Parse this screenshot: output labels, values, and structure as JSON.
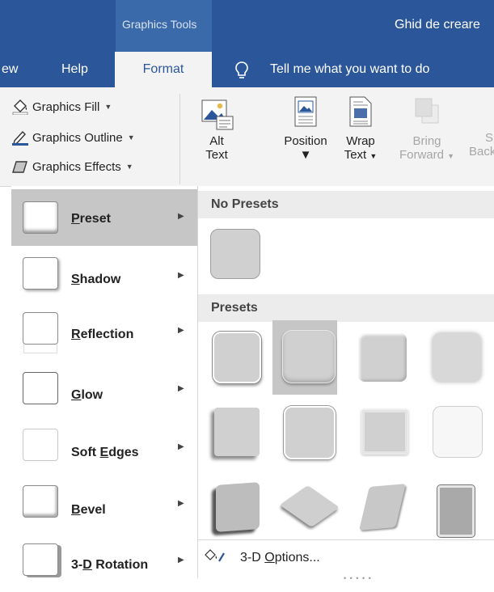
{
  "titlebar": {
    "context_group": "Graphics Tools",
    "document_title": "Ghid de creare"
  },
  "tabs": [
    {
      "label": "ew"
    },
    {
      "label": "Help"
    },
    {
      "label": "Format"
    }
  ],
  "tell_me": "Tell me what you want to do",
  "ribbon": {
    "graphics_fill": "Graphics Fill",
    "graphics_outline": "Graphics Outline",
    "graphics_effects": "Graphics Effects",
    "alt_text": [
      "Alt",
      "Text"
    ],
    "position": "Position",
    "wrap_text": [
      "Wrap",
      "Text"
    ],
    "bring_forward": [
      "Bring",
      "Forward"
    ],
    "send_backward": [
      "S",
      "Back"
    ]
  },
  "effects_menu": [
    {
      "label": "Preset",
      "accel": "P",
      "rest": "reset"
    },
    {
      "label": "Shadow",
      "accel": "S",
      "rest": "hadow"
    },
    {
      "label": "Reflection",
      "accel": "R",
      "rest": "eflection"
    },
    {
      "label": "Glow",
      "accel": "G",
      "rest": "low"
    },
    {
      "label": "Soft Edges",
      "pre": "Soft ",
      "accel": "E",
      "rest": "dges"
    },
    {
      "label": "Bevel",
      "accel": "B",
      "rest": "evel"
    },
    {
      "label": "3-D Rotation",
      "pre": "3-",
      "accel": "D",
      "rest": " Rotation"
    }
  ],
  "flyout": {
    "no_presets_header": "No Presets",
    "presets_header": "Presets",
    "options": {
      "pre": "3-D ",
      "accel": "O",
      "rest": "ptions..."
    }
  },
  "colors": {
    "accent": "#2b579a",
    "ribbon_bg": "#f3f3f3",
    "selected_bg": "#c6c6c6"
  }
}
